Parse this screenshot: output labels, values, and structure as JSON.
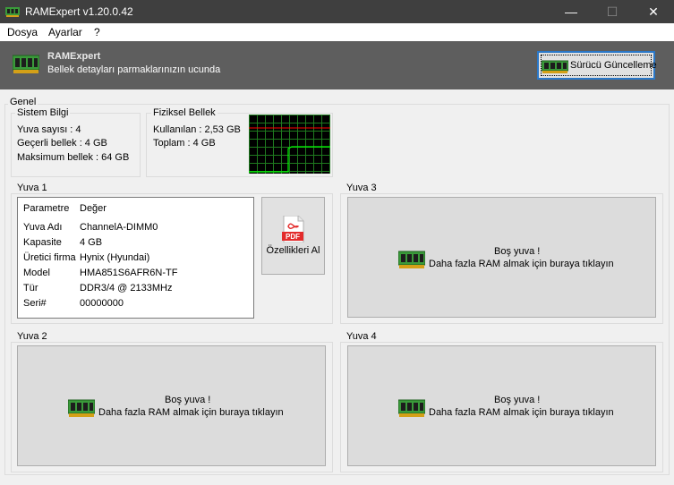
{
  "window": {
    "title": "RAMExpert v1.20.0.42",
    "min_glyph": "—",
    "max_glyph": "☐",
    "close_glyph": "✕"
  },
  "menu": {
    "file": "Dosya",
    "settings": "Ayarlar",
    "help": "?"
  },
  "header": {
    "title": "RAMExpert",
    "subtitle": "Bellek detayları parmaklarınızın ucunda",
    "driver_button": "Sürücü Güncelleme"
  },
  "general": {
    "title": "Genel",
    "system_info": {
      "title": "Sistem Bilgi",
      "slot_count": "Yuva sayısı : 4",
      "valid_memory": "Geçerli bellek : 4 GB",
      "max_memory": "Maksimum bellek : 64 GB"
    },
    "physical_memory": {
      "title": "Fiziksel Bellek",
      "used": "Kullanılan : 2,53 GB",
      "total": "Toplam : 4 GB",
      "usage_fraction": 0.63
    }
  },
  "slot1": {
    "title": "Yuva 1",
    "header": {
      "param": "Parametre",
      "value": "Değer"
    },
    "rows": [
      {
        "k": "Yuva Adı",
        "v": "ChannelA-DIMM0"
      },
      {
        "k": "Kapasite",
        "v": "4 GB"
      },
      {
        "k": "Üretici firma",
        "v": "Hynix (Hyundai)"
      },
      {
        "k": "Model",
        "v": "HMA851S6AFR6N-TF"
      },
      {
        "k": "Tür",
        "v": "DDR3/4 @ 2133MHz"
      },
      {
        "k": "Seri#",
        "v": "00000000"
      }
    ],
    "pdf_label": "PDF",
    "pdf_button": "Özellikleri Al"
  },
  "empty_text_1": "Boş yuva !",
  "empty_text_2": "Daha fazla RAM almak için buraya tıklayın",
  "slot2": {
    "title": "Yuva 2"
  },
  "slot3": {
    "title": "Yuva 3"
  },
  "slot4": {
    "title": "Yuva 4"
  },
  "colors": {
    "graph_grid": "#1f7a1f",
    "graph_line": "#00ff00",
    "graph_total": "#ff0000",
    "title_bar": "#3f3f3f",
    "header_bar": "#5e5e5e"
  },
  "icons": {
    "app": "ram-icon",
    "header": "ram-icon",
    "pdf": "pdf-icon"
  }
}
